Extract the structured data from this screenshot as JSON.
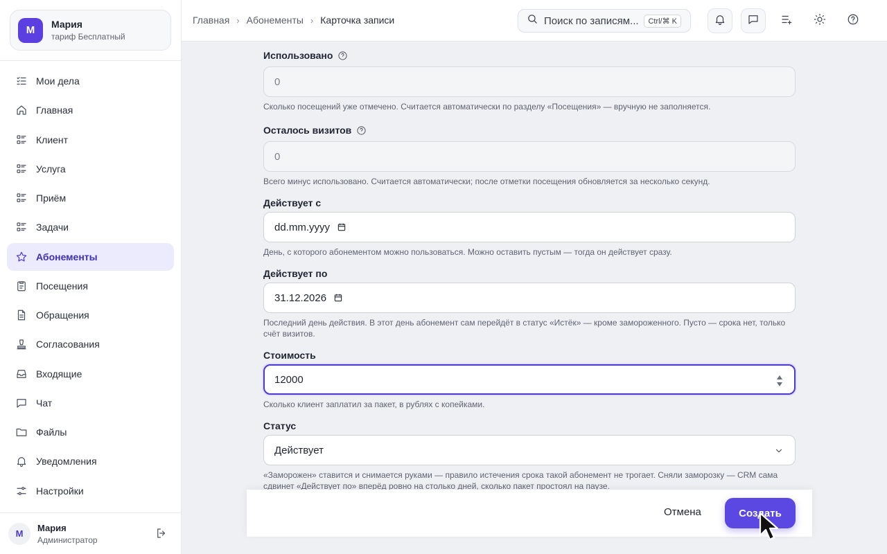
{
  "account": {
    "avatar_letter": "М",
    "name": "Мария",
    "plan": "тариф Бесплатный"
  },
  "sidebar": {
    "items": [
      {
        "label": "Мои дела",
        "icon": "checklist-icon"
      },
      {
        "label": "Главная",
        "icon": "home-icon"
      },
      {
        "label": "Клиент",
        "icon": "list-icon"
      },
      {
        "label": "Услуга",
        "icon": "list-icon"
      },
      {
        "label": "Приём",
        "icon": "list-icon"
      },
      {
        "label": "Задачи",
        "icon": "list-icon"
      },
      {
        "label": "Абонементы",
        "icon": "star-icon",
        "active": true
      },
      {
        "label": "Посещения",
        "icon": "clipboard-icon"
      },
      {
        "label": "Обращения",
        "icon": "document-icon"
      },
      {
        "label": "Согласования",
        "icon": "stamp-icon"
      },
      {
        "label": "Входящие",
        "icon": "inbox-icon"
      },
      {
        "label": "Чат",
        "icon": "chat-icon"
      },
      {
        "label": "Файлы",
        "icon": "folder-icon"
      },
      {
        "label": "Уведомления",
        "icon": "bell-icon"
      },
      {
        "label": "Настройки",
        "icon": "settings-icon"
      }
    ]
  },
  "user": {
    "avatar_letter": "М",
    "name": "Мария",
    "role": "Администратор"
  },
  "header": {
    "breadcrumbs": [
      "Главная",
      "Абонементы",
      "Карточка записи"
    ],
    "search_placeholder": "Поиск по записям...",
    "search_shortcut": "Ctrl/⌘ K"
  },
  "form": {
    "used": {
      "label": "Использовано",
      "value": "0",
      "hint": "Сколько посещений уже отмечено. Считается автоматически по разделу «Посещения» — вручную не заполняется."
    },
    "remaining": {
      "label": "Осталось визитов",
      "value": "0",
      "hint": "Всего минус использовано. Считается автоматически; после отметки посещения обновляется за несколько секунд."
    },
    "valid_from": {
      "label": "Действует с",
      "value": "dd.mm.yyyy",
      "hint": "День, с которого абонементом можно пользоваться. Можно оставить пустым — тогда он действует сразу."
    },
    "valid_to": {
      "label": "Действует по",
      "value": "31.12.2026",
      "hint": "Последний день действия. В этот день абонемент сам перейдёт в статус «Истёк» — кроме замороженного. Пусто — срока нет, только счёт визитов."
    },
    "price": {
      "label": "Стоимость",
      "value": "12000",
      "hint": "Сколько клиент заплатил за пакет, в рублях с копейками."
    },
    "status": {
      "label": "Статус",
      "value": "Действует",
      "hint": "«Заморожен» ставится и снимается руками — правило истечения срока такой абонемент не трогает. Сняли заморозку — CRM сама сдвинет «Действует по» вперёд ровно на столько дней, сколько пакет простоял на паузе."
    }
  },
  "actions": {
    "cancel_label": "Отмена",
    "create_label": "Создать"
  },
  "colors": {
    "accent": "#5b48e3",
    "active_nav_bg": "#ecebfd",
    "main_bg": "#eef0f4"
  }
}
